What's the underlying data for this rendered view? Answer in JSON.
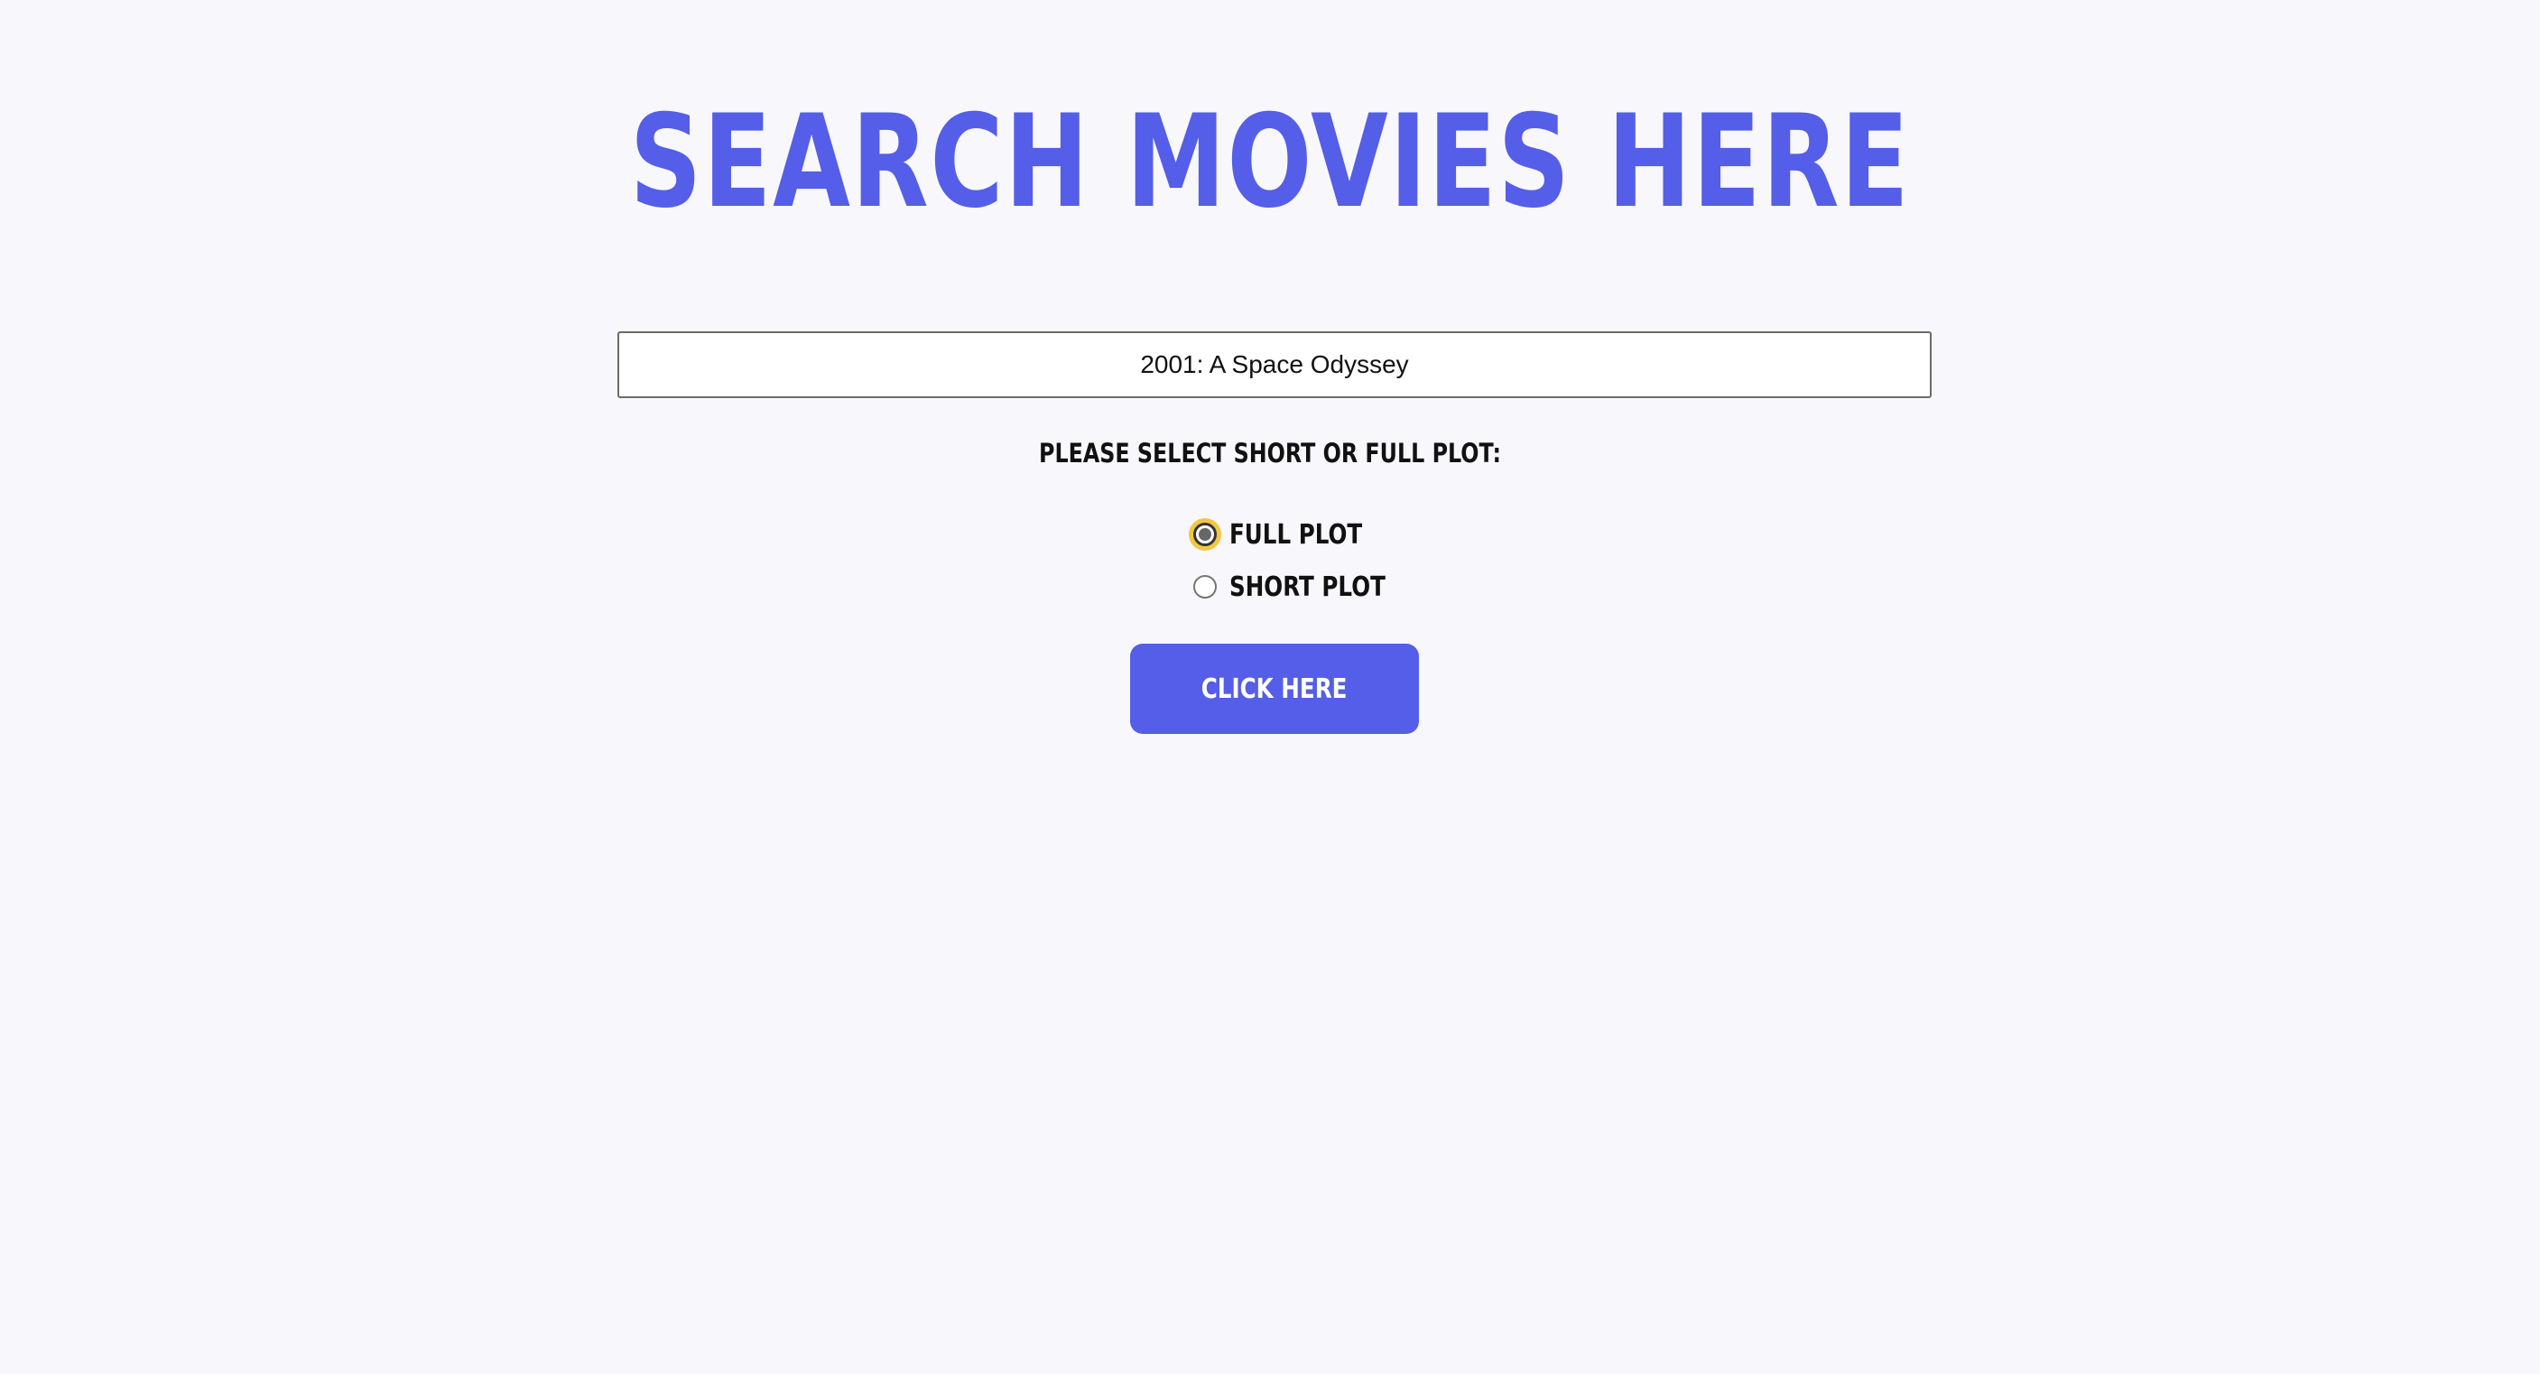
{
  "header": {
    "title": "SEARCH MOVIES HERE"
  },
  "search": {
    "value": "2001: A Space Odyssey",
    "placeholder": ""
  },
  "plot_selection": {
    "prompt": "PLEASE SELECT SHORT OR FULL PLOT:",
    "options": [
      {
        "label": "FULL PLOT",
        "selected": true
      },
      {
        "label": "SHORT PLOT",
        "selected": false
      }
    ]
  },
  "submit": {
    "label": "CLICK HERE"
  },
  "colors": {
    "accent": "#545ee8",
    "background": "#f8f7fc",
    "focus_ring": "#f2c744"
  }
}
